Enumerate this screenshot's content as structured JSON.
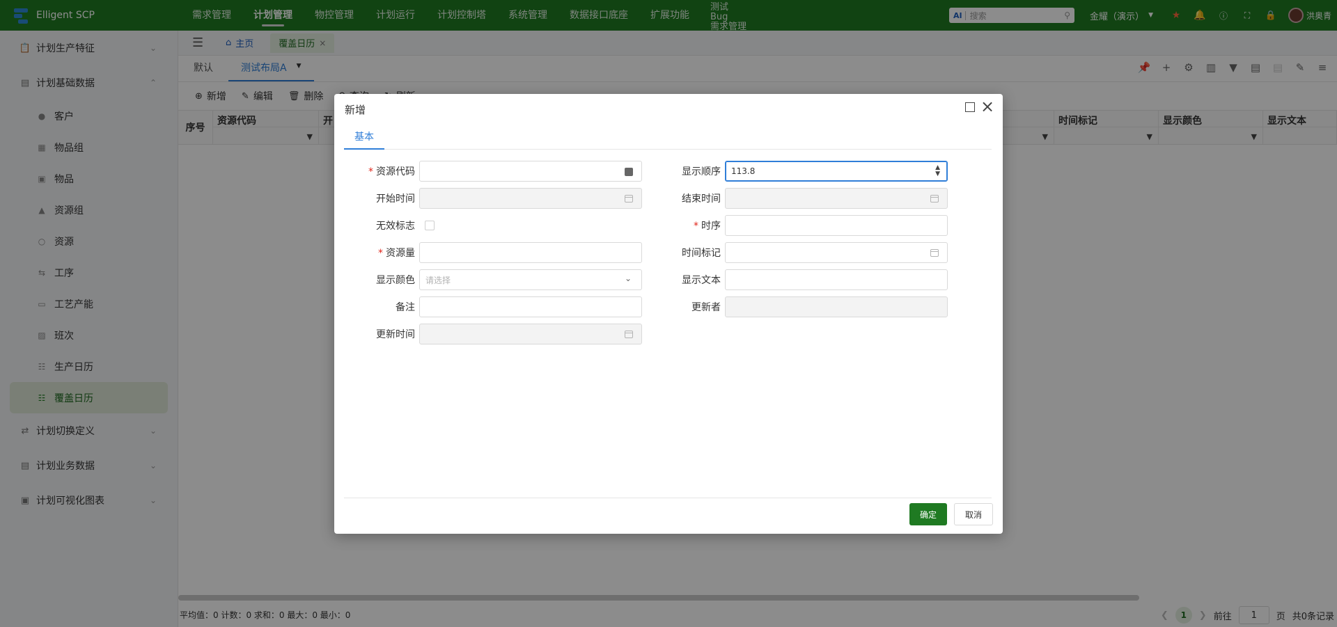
{
  "app": {
    "title": "Elligent SCP"
  },
  "nav": {
    "items": [
      "需求管理",
      "计划管理",
      "物控管理",
      "计划运行",
      "计划控制塔",
      "系统管理",
      "数据接口底座",
      "扩展功能"
    ],
    "active_index": 1,
    "stacked": [
      "测试",
      "Bug",
      "需求管理"
    ]
  },
  "top_right": {
    "search_placeholder": "搜索",
    "ai_label": "AI",
    "tenant": "金耀（演示）",
    "user": "洪奥青"
  },
  "sidebar": {
    "groups": [
      {
        "label": "计划生产特征",
        "icon": "clipboard-icon",
        "expanded": false
      },
      {
        "label": "计划基础数据",
        "icon": "database-icon",
        "expanded": true
      },
      {
        "label": "计划切换定义",
        "icon": "switch-icon",
        "expanded": false
      },
      {
        "label": "计划业务数据",
        "icon": "document-icon",
        "expanded": false
      },
      {
        "label": "计划可视化图表",
        "icon": "chart-icon",
        "expanded": false
      }
    ],
    "items": [
      {
        "label": "客户",
        "icon": "user-icon"
      },
      {
        "label": "物品组",
        "icon": "grid-icon"
      },
      {
        "label": "物品",
        "icon": "box-icon"
      },
      {
        "label": "资源组",
        "icon": "hierarchy-icon"
      },
      {
        "label": "资源",
        "icon": "resource-icon"
      },
      {
        "label": "工序",
        "icon": "process-icon"
      },
      {
        "label": "工艺产能",
        "icon": "capacity-icon"
      },
      {
        "label": "班次",
        "icon": "shift-icon"
      },
      {
        "label": "生产日历",
        "icon": "calendar-icon"
      },
      {
        "label": "覆盖日历",
        "icon": "calendar-override-icon",
        "active": true
      }
    ]
  },
  "page_tabs": {
    "home": "主页",
    "current": "覆盖日历"
  },
  "view_tabs": {
    "default": "默认",
    "active": "测试布局A"
  },
  "actions": {
    "add": "新增",
    "edit": "编辑",
    "delete": "删除",
    "query": "查询",
    "refresh": "刷新"
  },
  "grid": {
    "seq_header": "序号",
    "columns": [
      "资源代码",
      "开",
      "时间标记",
      "显示颜色",
      "显示文本"
    ]
  },
  "status": {
    "summary": "平均值：0 计数：0 求和：0 最大：0 最小：0",
    "page": "1",
    "goto_label": "前往",
    "page_input": "1",
    "page_suffix": "页",
    "total": "共0条记录"
  },
  "modal": {
    "title": "新增",
    "tab": "基本",
    "fields": {
      "resource_code": {
        "label": "资源代码",
        "value": ""
      },
      "start_time": {
        "label": "开始时间",
        "value": ""
      },
      "invalid_flag": {
        "label": "无效标志"
      },
      "resource_qty": {
        "label": "资源量",
        "value": ""
      },
      "display_color": {
        "label": "显示颜色",
        "placeholder": "请选择"
      },
      "remark": {
        "label": "备注",
        "value": ""
      },
      "update_time": {
        "label": "更新时间",
        "value": ""
      },
      "display_order": {
        "label": "显示顺序",
        "value": "113.8"
      },
      "end_time": {
        "label": "结束时间",
        "value": ""
      },
      "sequence": {
        "label": "时序",
        "value": ""
      },
      "time_mark": {
        "label": "时间标记",
        "value": ""
      },
      "display_text": {
        "label": "显示文本",
        "value": ""
      },
      "updater": {
        "label": "更新者",
        "value": ""
      }
    },
    "ok": "确定",
    "cancel": "取消"
  },
  "colors": {
    "brand": "#1f7a22",
    "accent": "#2f7ed8",
    "required": "#e0261b"
  }
}
